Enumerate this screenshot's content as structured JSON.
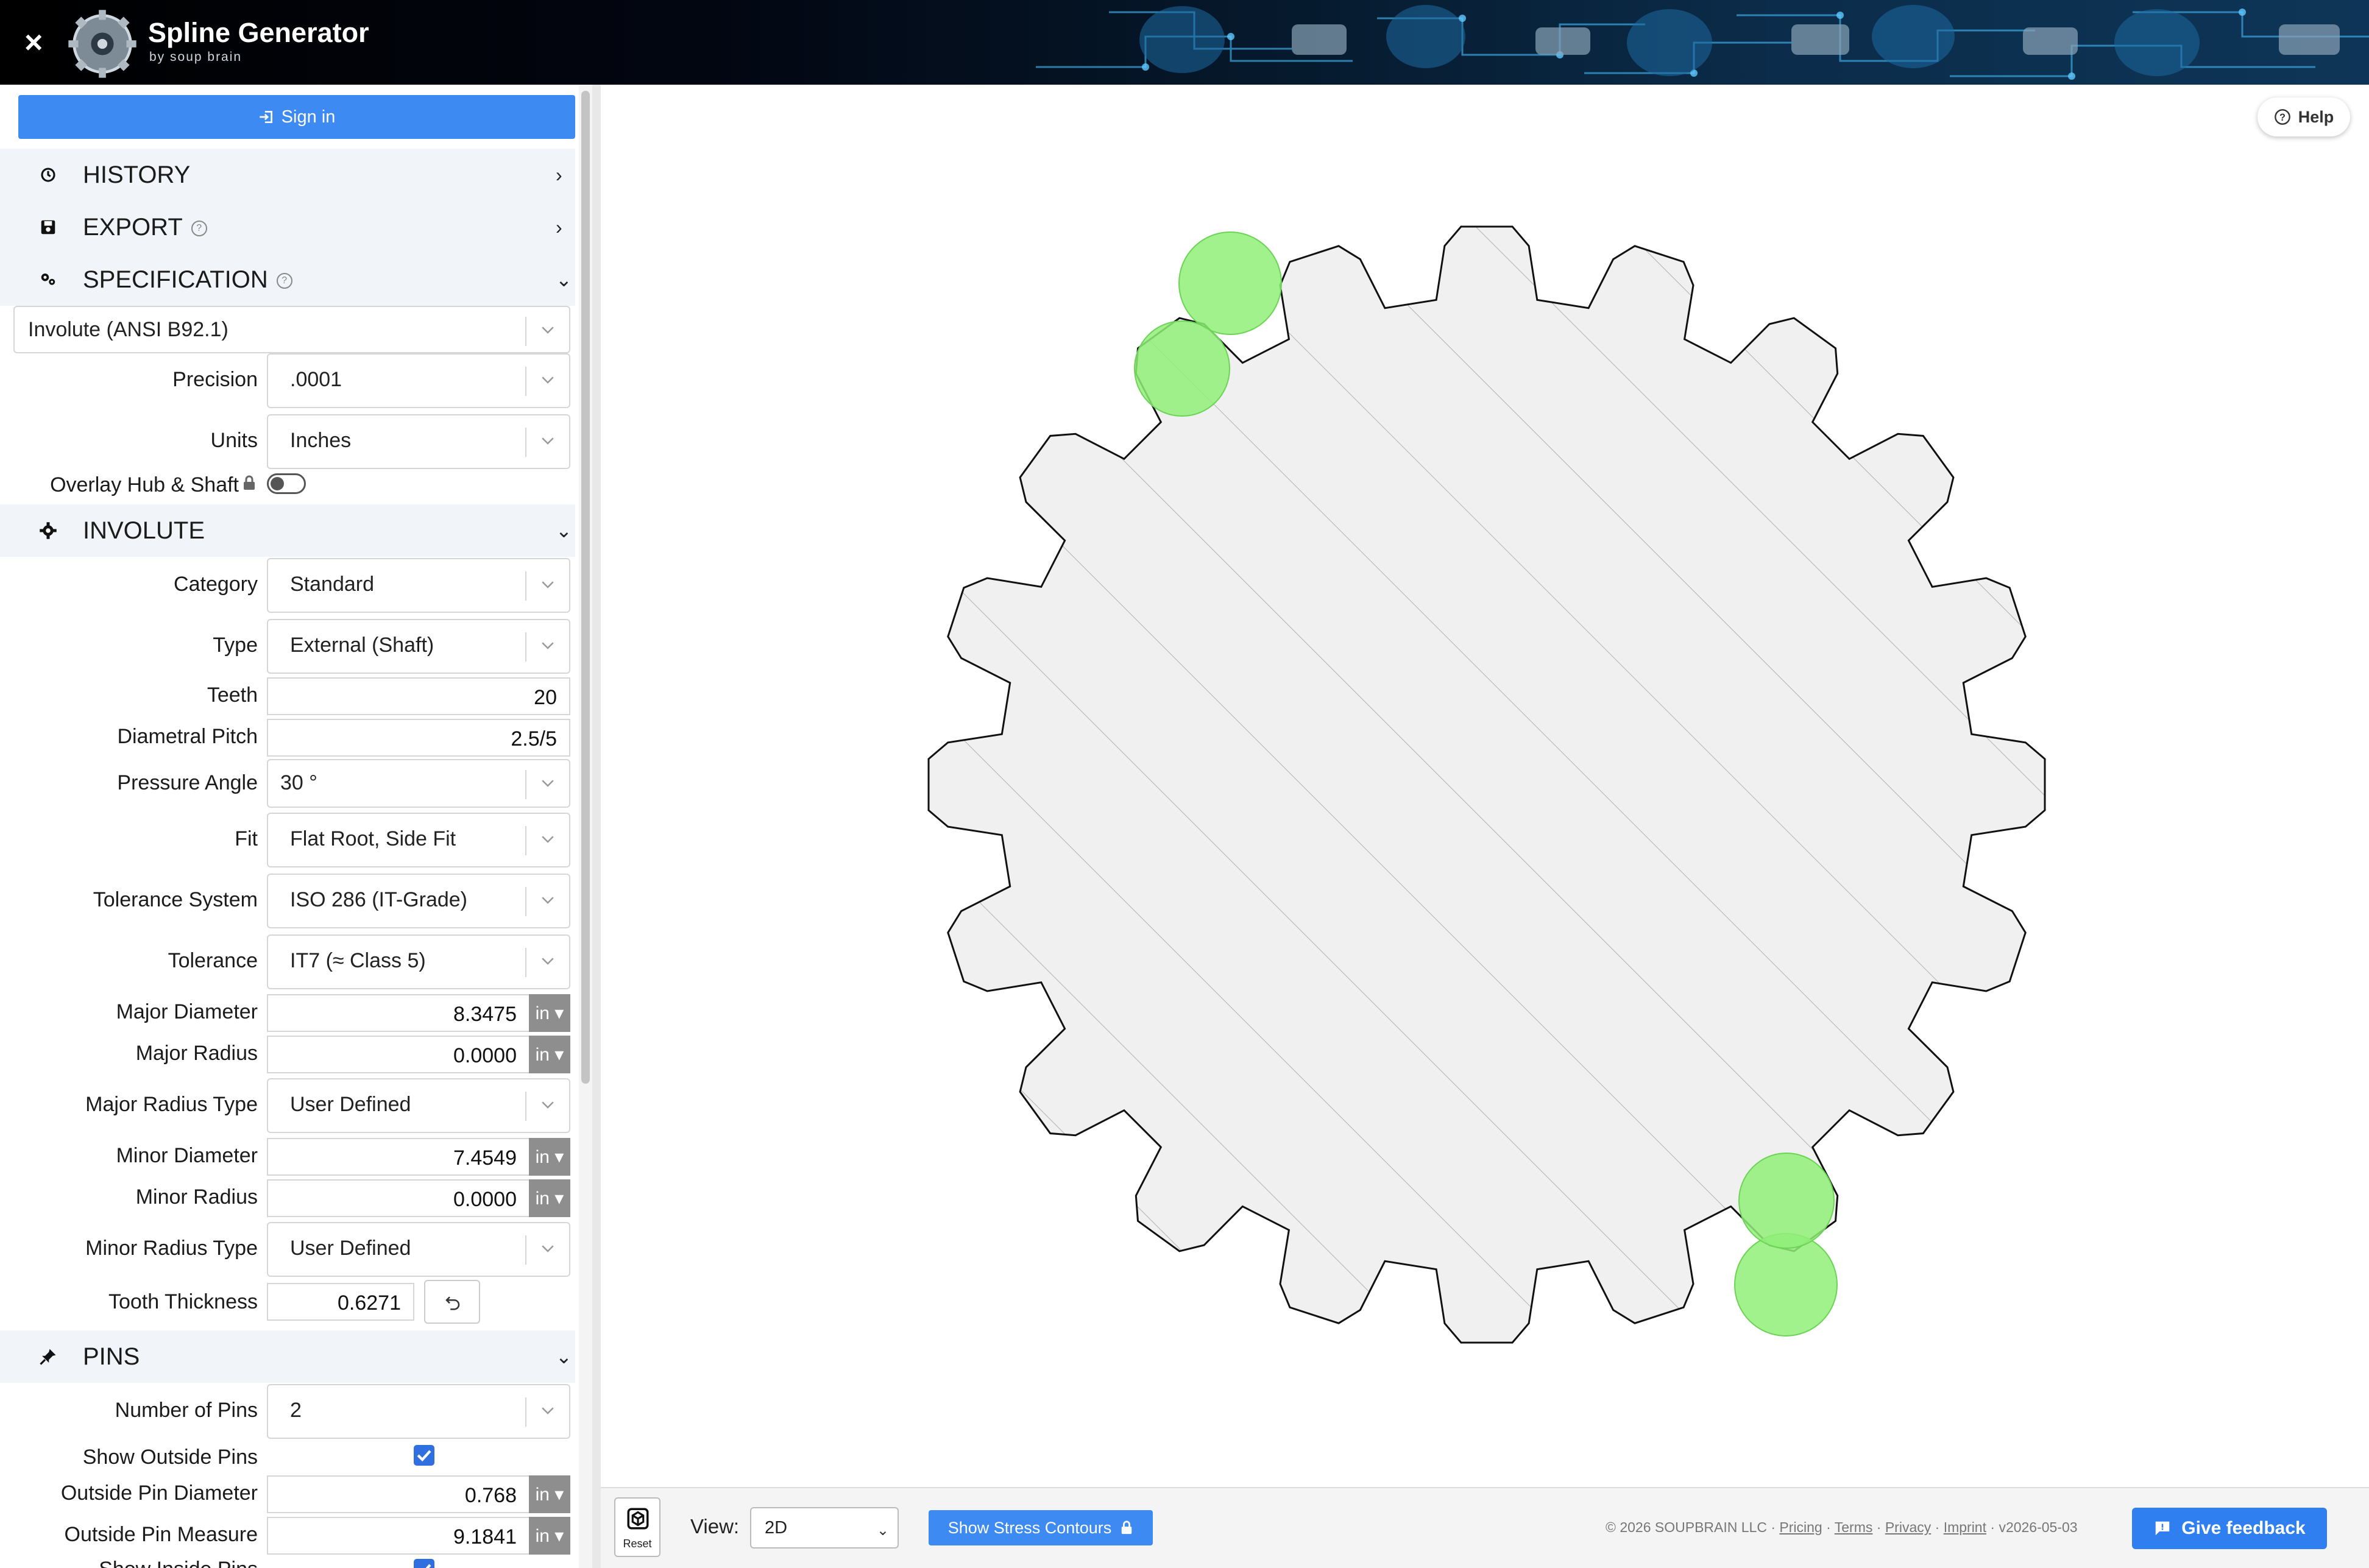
{
  "header": {
    "close_label": "×",
    "title": "Spline Generator",
    "subtitle": "by soup brain"
  },
  "sidebar": {
    "signin_label": "Sign in",
    "sections": {
      "history": "HISTORY",
      "export": "EXPORT",
      "specification": "SPECIFICATION",
      "involute": "INVOLUTE",
      "pins": "PINS"
    },
    "spec_standard": "Involute (ANSI B92.1)",
    "fields": {
      "precision": {
        "label": "Precision",
        "value": ".0001"
      },
      "units": {
        "label": "Units",
        "value": "Inches"
      },
      "overlay": {
        "label": "Overlay Hub & Shaft",
        "checked": false
      },
      "category": {
        "label": "Category",
        "value": "Standard"
      },
      "type": {
        "label": "Type",
        "value": "External (Shaft)"
      },
      "teeth": {
        "label": "Teeth",
        "value": "20"
      },
      "diametral_pitch": {
        "label": "Diametral Pitch",
        "value": "2.5/5"
      },
      "pressure_angle": {
        "label": "Pressure Angle",
        "value": "30 °"
      },
      "fit": {
        "label": "Fit",
        "value": "Flat Root, Side Fit"
      },
      "tolerance_system": {
        "label": "Tolerance System",
        "value": "ISO 286 (IT-Grade)"
      },
      "tolerance": {
        "label": "Tolerance",
        "value": "IT7 (≈ Class 5)"
      },
      "major_diameter": {
        "label": "Major Diameter",
        "value": "8.3475",
        "unit": "in ▾"
      },
      "major_radius": {
        "label": "Major Radius",
        "value": "0.0000",
        "unit": "in ▾"
      },
      "major_radius_type": {
        "label": "Major Radius Type",
        "value": "User Defined"
      },
      "minor_diameter": {
        "label": "Minor Diameter",
        "value": "7.4549",
        "unit": "in ▾"
      },
      "minor_radius": {
        "label": "Minor Radius",
        "value": "0.0000",
        "unit": "in ▾"
      },
      "minor_radius_type": {
        "label": "Minor Radius Type",
        "value": "User Defined"
      },
      "tooth_thickness": {
        "label": "Tooth Thickness",
        "value": "0.6271"
      },
      "number_of_pins": {
        "label": "Number of Pins",
        "value": "2"
      },
      "show_outside_pins": {
        "label": "Show Outside Pins",
        "checked": true
      },
      "outside_pin_diameter": {
        "label": "Outside Pin Diameter",
        "value": "0.768",
        "unit": "in ▾"
      },
      "outside_pin_measure": {
        "label": "Outside Pin Measure",
        "value": "9.1841",
        "unit": "in ▾"
      },
      "show_inside_pins": {
        "label": "Show Inside Pins",
        "checked": true
      }
    }
  },
  "canvas": {
    "help_label": "Help",
    "gear": {
      "teeth": 20,
      "pins": 2,
      "pin_color": "#90ee78",
      "fill": "#f0f0f0",
      "stroke": "#111111"
    }
  },
  "bottombar": {
    "reset_label": "Reset",
    "view_label": "View:",
    "view_value": "2D",
    "stress_label": "Show Stress Contours",
    "copyright": "© 2026 SOUPBRAIN LLC",
    "links": [
      "Pricing",
      "Terms",
      "Privacy",
      "Imprint"
    ],
    "version": "v2026-05-03",
    "feedback_label": "Give feedback"
  },
  "colors": {
    "accent": "#3d8bf2",
    "feedback": "#2f7ff0",
    "section_bg": "#f1f4f9",
    "unit_bg": "#8e8e8e"
  }
}
